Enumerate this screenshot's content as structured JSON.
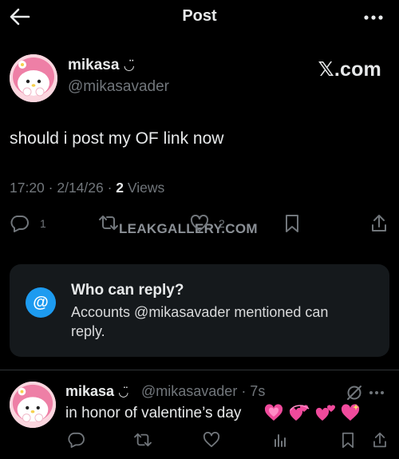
{
  "header": {
    "title": "Post"
  },
  "post": {
    "author_name": "mikasa",
    "name_emoji": "◡̈",
    "handle": "@mikasavader",
    "brand": "𝕏.com",
    "text": "should i post my OF link now",
    "meta_prefix": "17:20 · 2/14/26 · ",
    "views_count": "2",
    "views_label": " Views",
    "replies_count": "1",
    "likes_count": "2",
    "watermark": "LEAKGALLERY.COM"
  },
  "reply_settings": {
    "icon": "@",
    "title": "Who can reply?",
    "description": "Accounts @mikasavader mentioned can reply."
  },
  "thread_post": {
    "author_name": "mikasa",
    "name_emoji": "◡̈",
    "handle_time": "@mikasavader · 7s",
    "text": "in honor of valentine’s day",
    "emojis": [
      "growing-heart",
      "revolving-hearts",
      "two-hearts",
      "sparkling-heart"
    ]
  },
  "colors": {
    "background": "#000000",
    "text_primary": "#e7e9ea",
    "text_secondary": "#71767b",
    "accent": "#1d9bf0",
    "card": "#15191c",
    "heart": "#f04a9c"
  },
  "icons": {
    "back": "arrow-left-icon",
    "more": "more-horizontal-icon",
    "reply": "reply-bubble-icon",
    "repost": "repost-icon",
    "like": "heart-icon",
    "views": "bar-chart-icon",
    "bookmark": "bookmark-icon",
    "share": "share-icon",
    "grok": "grok-icon",
    "at": "at-sign-icon"
  }
}
